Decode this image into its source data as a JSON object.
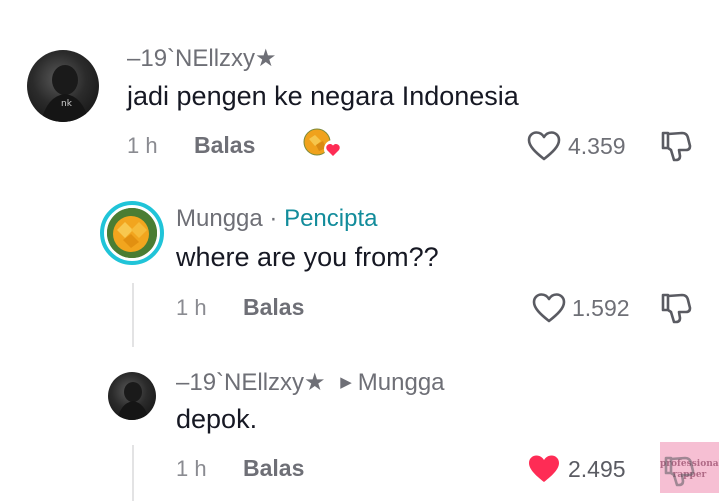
{
  "comments": [
    {
      "username": "–19`NEllzxy★",
      "text": "jadi pengen ke negara Indonesia",
      "time": "1 h",
      "reply_label": "Balas",
      "likes": "4.359",
      "liked": false
    },
    {
      "username": "Mungga",
      "separator": " · ",
      "creator_label": "Pencipta",
      "text": "where are you from??",
      "time": "1 h",
      "reply_label": "Balas",
      "likes": "1.592",
      "liked": false
    },
    {
      "username": "–19`NEllzxy★",
      "reply_to": "Mungga",
      "text": "depok.",
      "time": "1 h",
      "reply_label": "Balas",
      "likes": "2.495",
      "liked": true
    }
  ],
  "watermark": {
    "line1": "professional",
    "line2": "rapper"
  },
  "colors": {
    "like_red": "#fe2c55",
    "creator_teal": "#128c9b",
    "avatar_ring": "#20c4d8"
  }
}
